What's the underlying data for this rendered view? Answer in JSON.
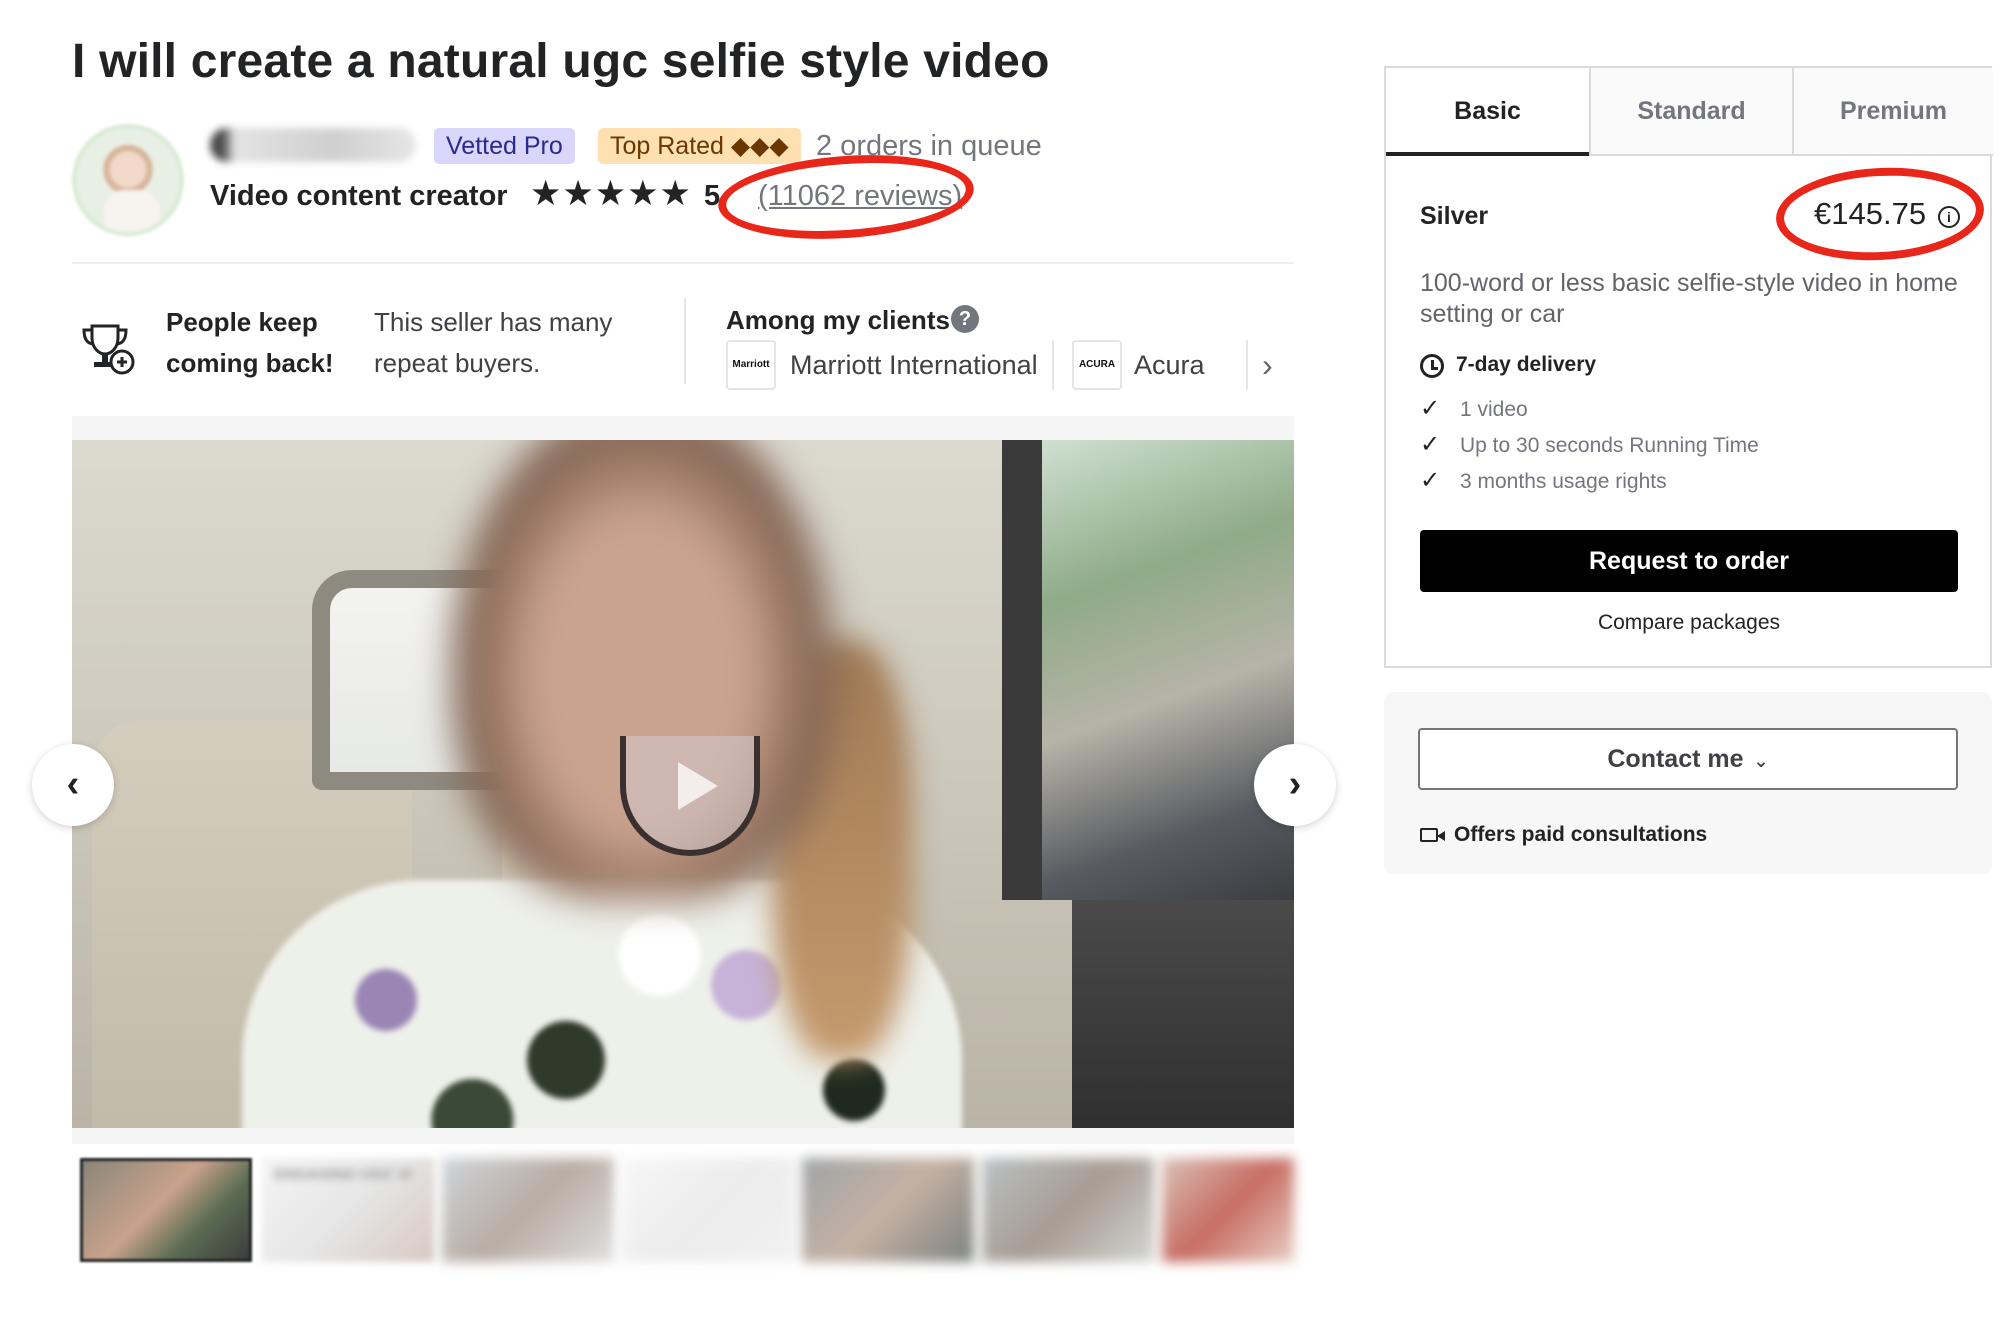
{
  "title": "I will create a natural ugc selfie style video",
  "seller": {
    "badges": {
      "vetted": "Vetted Pro",
      "top_rated": "Top Rated ◆◆◆"
    },
    "queue": "2 orders in queue",
    "subtitle": "Video content creator",
    "stars": "★★★★★",
    "rating": "5",
    "reviews": "(11062 reviews)"
  },
  "highlights": {
    "keep_title": "People keep coming back!",
    "keep_text": "This seller has many repeat buyers.",
    "clients_title": "Among my clients",
    "help": "?",
    "clients": [
      {
        "logo": "Marriott",
        "name": "Marriott International"
      },
      {
        "logo": "ACURA",
        "name": "Acura"
      }
    ],
    "next": "›"
  },
  "gallery": {
    "prev": "‹",
    "next": "›",
    "thumb_label": "ENGAGING UGC VI"
  },
  "packages": {
    "tabs": [
      "Basic",
      "Standard",
      "Premium"
    ],
    "active_tab": "Basic",
    "name": "Silver",
    "price": "€145.75",
    "info": "i",
    "description": "100-word or less basic selfie-style video in home setting or car",
    "delivery": "7-day delivery",
    "features": [
      "1 video",
      "Up to 30 seconds Running Time",
      "3 months usage rights"
    ],
    "order_label": "Request to order",
    "compare_label": "Compare packages"
  },
  "contact": {
    "button_label": "Contact me",
    "chevron": "⌄",
    "consult": "Offers paid consultations"
  },
  "annotation_color": "#e8271a"
}
